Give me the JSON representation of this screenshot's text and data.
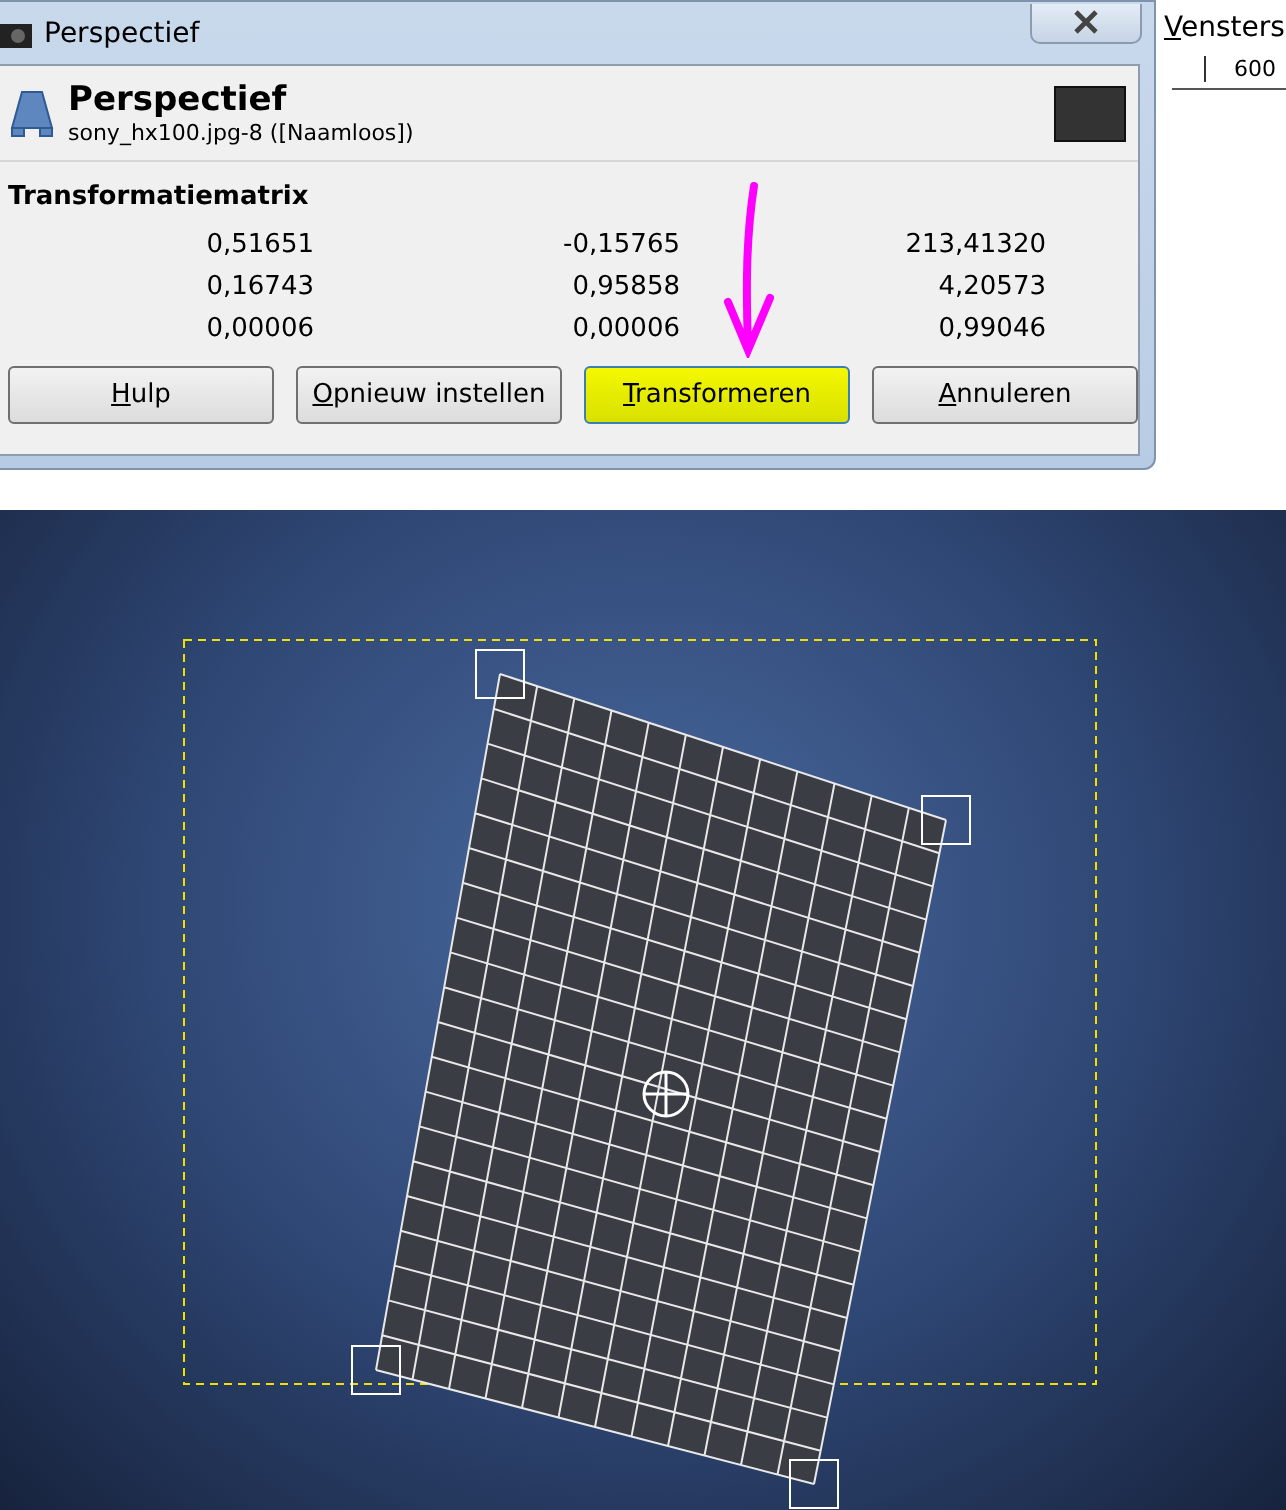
{
  "window": {
    "title": "Perspectief"
  },
  "menubar_item": {
    "label": "Vensters"
  },
  "ruler": {
    "label": "600"
  },
  "dialog": {
    "title": "Perspectief",
    "subtitle": "sony_hx100.jpg-8 ([Naamloos])"
  },
  "matrix": {
    "title": "Transformatiematrix",
    "rows": [
      [
        "0,51651",
        "-0,15765",
        "213,41320"
      ],
      [
        "0,16743",
        "0,95858",
        "4,20573"
      ],
      [
        "0,00006",
        "0,00006",
        "0,99046"
      ]
    ]
  },
  "buttons": [
    {
      "label": "Hulp",
      "highlighted": false
    },
    {
      "label": "Opnieuw instellen",
      "highlighted": false
    },
    {
      "label": "Transformeren",
      "highlighted": true
    },
    {
      "label": "Annuleren",
      "highlighted": false
    }
  ]
}
